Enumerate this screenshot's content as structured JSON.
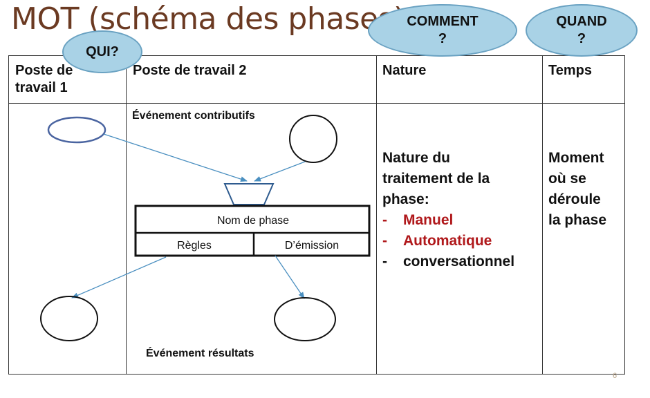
{
  "title": "MOT (schéma des phases)",
  "bubbles": {
    "qui": "QUI?",
    "comment": [
      "COMMENT",
      "?"
    ],
    "quand": [
      "QUAND",
      "?"
    ]
  },
  "headers": {
    "col1": [
      "Poste de",
      "travail 1"
    ],
    "col2": "Poste de travail 2",
    "col3": "Nature",
    "col4": "Temps"
  },
  "diagram": {
    "evenement_contributifs": "Événement contributifs",
    "nom_de_phase": "Nom de phase",
    "regles": "Règles",
    "emission": "D’émission",
    "evenement_resultats": "Événement résultats"
  },
  "nature": {
    "intro": [
      "Nature du",
      "traitement de la",
      "phase:"
    ],
    "items": [
      {
        "dash": "-",
        "text": "Manuel"
      },
      {
        "dash": "-",
        "text": "Automatique"
      },
      {
        "dash": "-",
        "text": "conversationnel"
      }
    ]
  },
  "temps": [
    "Moment",
    "où se",
    "déroule",
    "la phase"
  ],
  "page_number": "6",
  "colors": {
    "title": "#6b3a22",
    "bubble_fill": "#a9d2e6",
    "bubble_border": "#6aa2c2",
    "arrow": "#4a8fc0",
    "ellipse_blue": "#4a64a0",
    "emphasis_red": "#b0181b"
  }
}
